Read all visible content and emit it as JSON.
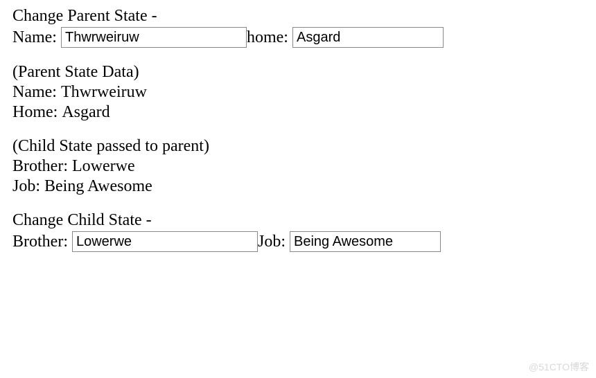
{
  "parentForm": {
    "heading": "Change Parent State -",
    "nameLabel": "Name: ",
    "nameValue": "Thwrweiruw",
    "homeLabel": "home: ",
    "homeValue": "Asgard"
  },
  "parentData": {
    "heading": "(Parent State Data)",
    "nameLabel": "Name: ",
    "nameValue": "Thwrweiruw",
    "homeLabel": "Home: ",
    "homeValue": "Asgard"
  },
  "childData": {
    "heading": "(Child State passed to parent)",
    "brotherLabel": "Brother: ",
    "brotherValue": "Lowerwe",
    "jobLabel": "Job: ",
    "jobValue": "Being Awesome"
  },
  "childForm": {
    "heading": "Change Child State -",
    "brotherLabel": "Brother: ",
    "brotherValue": "Lowerwe",
    "jobLabel": "Job: ",
    "jobValue": "Being Awesome"
  },
  "watermark": "@51CTO博客"
}
